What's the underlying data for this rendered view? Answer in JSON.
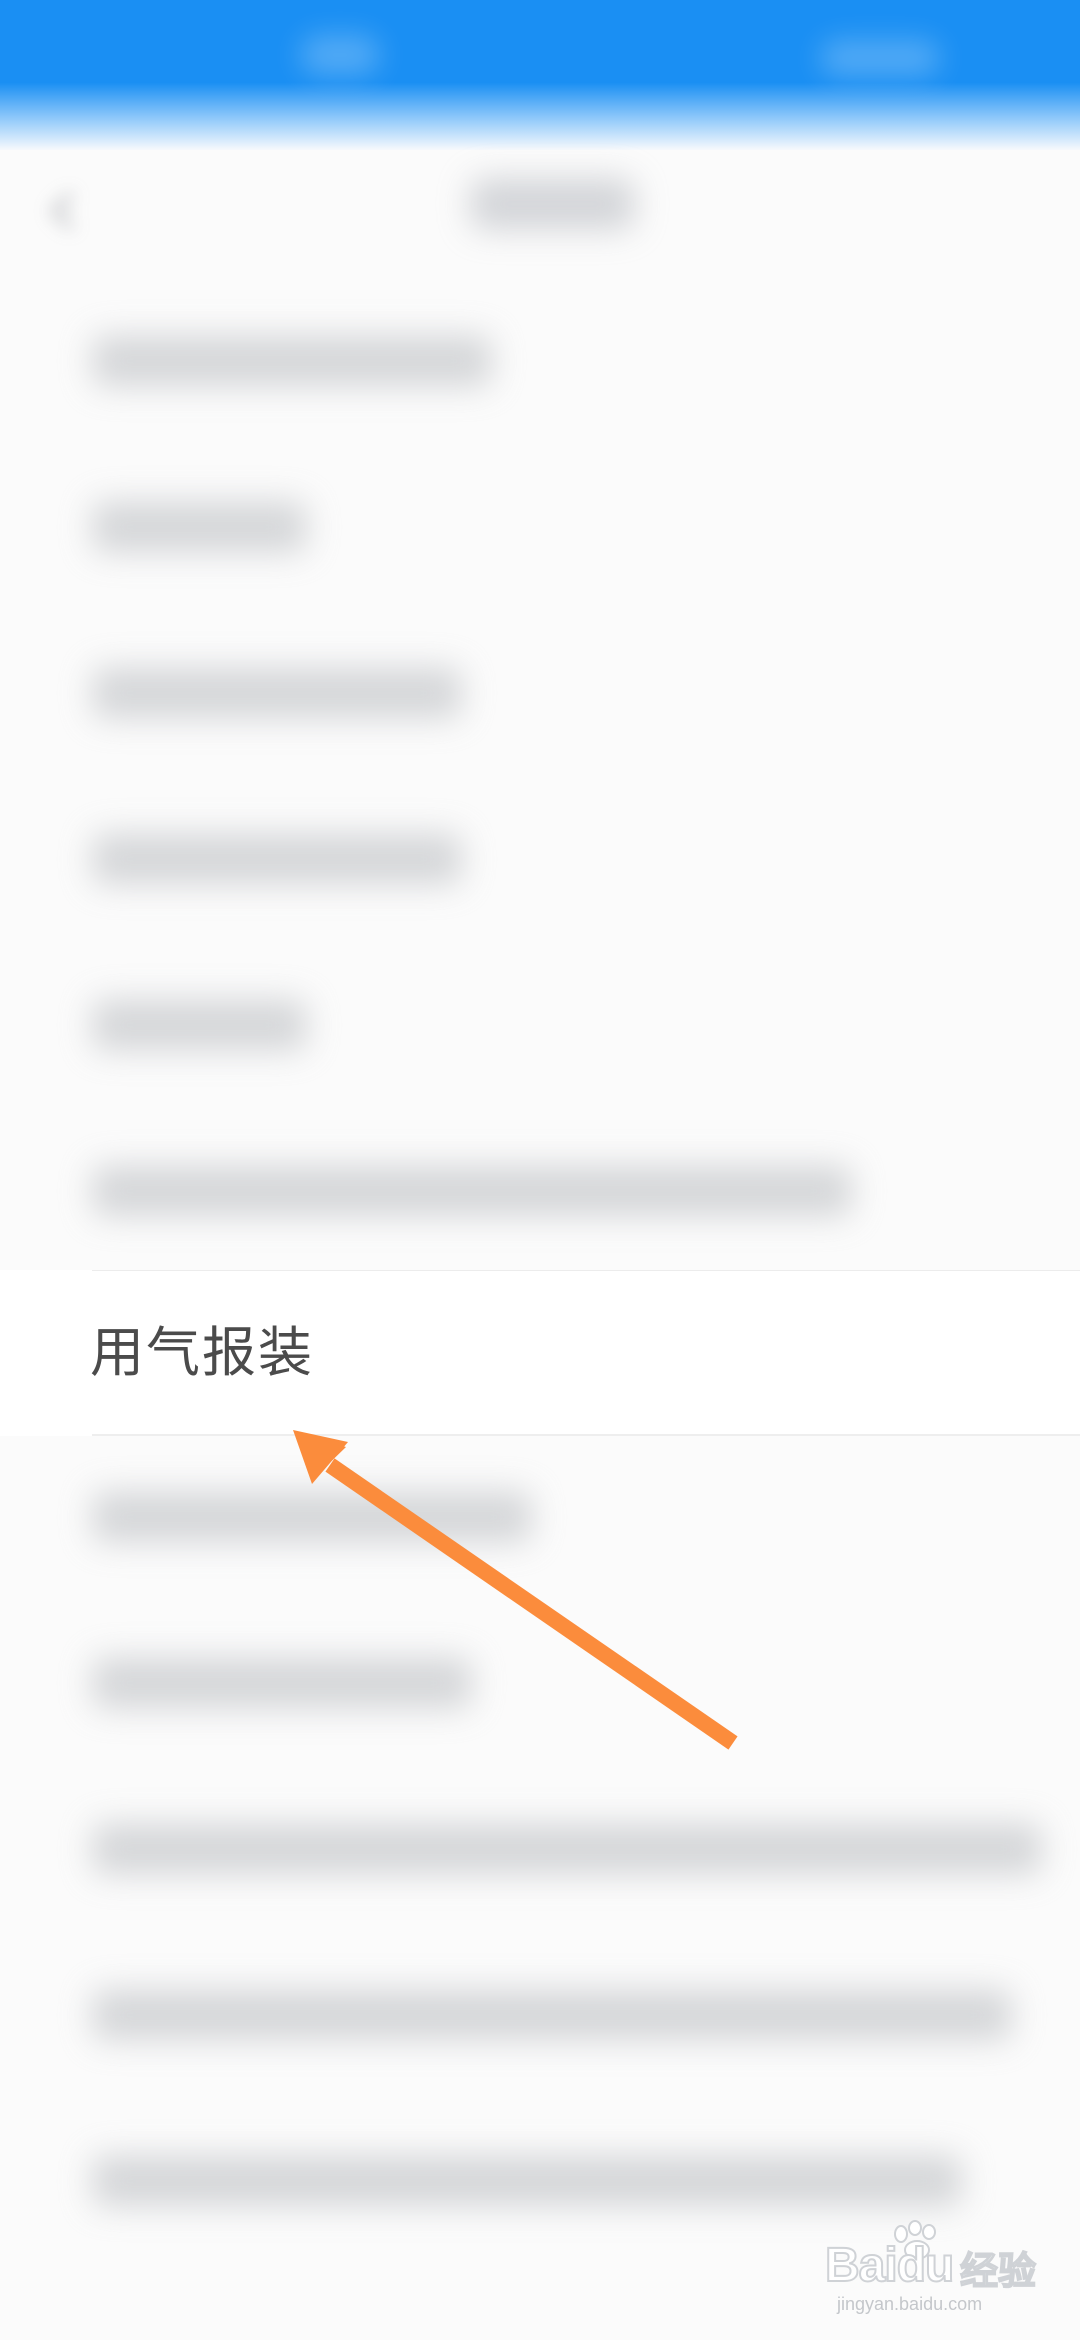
{
  "list": {
    "highlighted_item": "用气报装"
  },
  "watermark": {
    "brand": "Baidu",
    "suffix": "经验",
    "url": "jingyan.baidu.com"
  },
  "colors": {
    "status_bar": "#1a8ff3",
    "arrow": "#fb8c3c",
    "item_text": "#4b4b4b",
    "background": "#fbfbfb"
  },
  "icons": {
    "back": "back-arrow-icon",
    "pointer": "pointer-arrow-icon"
  }
}
